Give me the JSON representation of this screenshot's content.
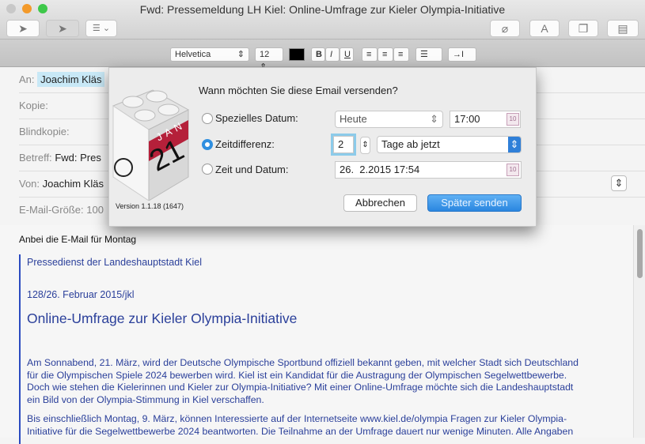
{
  "window": {
    "title": "Fwd: Pressemeldung LH Kiel: Online-Umfrage zur Kieler Olympia-Initiative"
  },
  "toolbar": {
    "send": "➤",
    "send_later": "➤",
    "list": "☰ ⌄",
    "attach": "⌀",
    "font": "A",
    "window": "❐",
    "template": "▤"
  },
  "format": {
    "font": "Helvetica",
    "size": "12",
    "bold": "B",
    "italic": "I",
    "underline": "U",
    "align_left": "≡",
    "align_center": "≡",
    "align_right": "≡",
    "list": "☰ ⌄",
    "indent": "→I ⌄",
    "color": "#000000"
  },
  "header": {
    "to_label": "An:",
    "to_value": "Joachim Kläs",
    "cc_label": "Kopie:",
    "bcc_label": "Blindkopie:",
    "subject_label": "Betreff:",
    "subject_value": "Fwd: Pres",
    "from_label": "Von:",
    "from_value": "Joachim Kläs",
    "size_label": "E-Mail-Größe:",
    "size_value": "100"
  },
  "dialog": {
    "question": "Wann möchten Sie diese Email versenden?",
    "option_date": "Spezielles Datum:",
    "date_select": "Heute",
    "date_time": "17:00",
    "option_offset": "Zeitdifferenz:",
    "offset_value": "2",
    "offset_unit": "Tage ab jetzt",
    "option_datetime": "Zeit und Datum:",
    "datetime_value": "26.  2.2015 17:54",
    "cancel": "Abbrechen",
    "confirm": "Später senden",
    "version": "Version 1.1.18 (1647)",
    "icon_month": "JAN",
    "icon_day": "21",
    "selected": "offset"
  },
  "body": {
    "intro": "Anbei die E-Mail für Montag",
    "sender": "Pressedienst der Landeshauptstadt Kiel",
    "ref": "128/26. Februar 2015/jkl",
    "headline": "Online-Umfrage zur Kieler Olympia-Initiative",
    "para1": [
      "Am Sonnabend, 21. März, wird der Deutsche Olympische Sportbund offiziell bekannt geben, mit welcher Stadt sich Deutschland",
      "für die Olympischen Spiele 2024 bewerben wird. Kiel ist ein Kandidat für die Austragung der Olympischen Segelwettbewerbe.",
      "Doch wie stehen die Kielerinnen und Kieler zur Olympia-Initiative? Mit einer Online-Umfrage möchte sich die Landeshauptstadt",
      "ein Bild von der Olympia-Stimmung in Kiel verschaffen."
    ],
    "para2": [
      "Bis einschließlich Montag, 9. März, können Interessierte auf der Internetseite www.kiel.de/olympia Fragen zur Kieler Olympia-",
      "Initiative für die Segelwettbewerbe 2024 beantworten. Die Teilnahme an der Umfrage dauert nur wenige Minuten. Alle Angaben"
    ]
  }
}
